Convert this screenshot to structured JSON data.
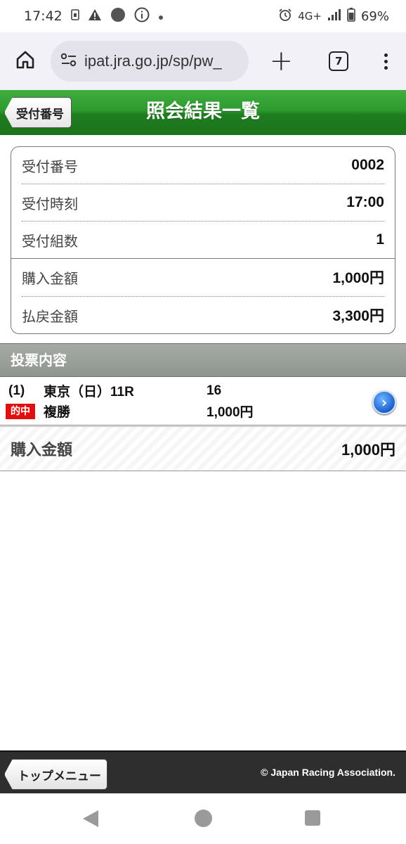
{
  "status_bar": {
    "time": "17:42",
    "network": "4G+",
    "battery": "69%"
  },
  "browser": {
    "url": "ipat.jra.go.jp/sp/pw_",
    "tab_count": "7",
    "plus_label": "+"
  },
  "header": {
    "back_label": "受付番号",
    "title": "照会結果一覧",
    "color": "#2e9a2e"
  },
  "info": {
    "rows": [
      {
        "label": "受付番号",
        "value": "0002"
      },
      {
        "label": "受付時刻",
        "value": "17:00"
      },
      {
        "label": "受付組数",
        "value": "1"
      },
      {
        "label": "購入金額",
        "value": "1,000円"
      },
      {
        "label": "払戻金額",
        "value": "3,300円"
      }
    ]
  },
  "section": {
    "title": "投票内容"
  },
  "bet": {
    "number": "(1)",
    "venue_day": "東京（日）",
    "race": "11R",
    "combination": "16",
    "hit_label": "的中",
    "bet_type": "複勝",
    "amount": "1,000円",
    "detail_icon": "›"
  },
  "total": {
    "label": "購入金額",
    "value": "1,000円"
  },
  "footer": {
    "top_menu_label": "トップメニュー",
    "copyright": "© Japan Racing Association."
  }
}
